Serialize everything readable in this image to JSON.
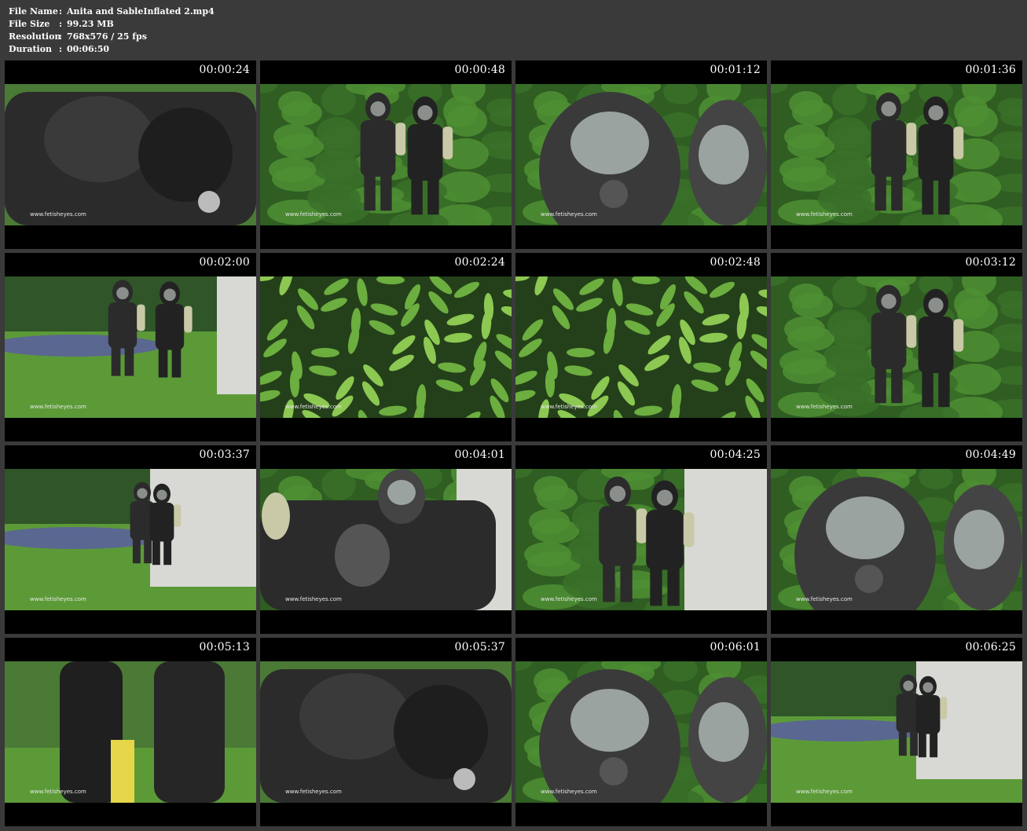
{
  "file_info": {
    "rows": [
      {
        "label": "File Name",
        "sep": ":",
        "value": "Anita and SableInflated 2.mp4"
      },
      {
        "label": "File Size",
        "sep": ":",
        "value": "99.23 MB"
      },
      {
        "label": "Resolution",
        "sep": ":",
        "value": "768x576 / 25 fps"
      },
      {
        "label": "Duration",
        "sep": ":",
        "value": "00:06:50"
      }
    ]
  },
  "watermark": "www.fetisheyes.com",
  "colors": {
    "page_bg": "#3a3a3a",
    "thumb_bg": "#000000",
    "text": "#ffffff",
    "foliage": "#3f7a2c",
    "suit": "#2b2b2b",
    "grass": "#5c9a38",
    "wall": "#d8d8d4",
    "flowers": "#5a5aa8"
  },
  "thumbnails": [
    {
      "time": "00:00:24",
      "scene": "closeup-suits",
      "icon": "video-frame"
    },
    {
      "time": "00:00:48",
      "scene": "two-figures-foliage",
      "icon": "video-frame"
    },
    {
      "time": "00:01:12",
      "scene": "closeup-masks",
      "icon": "video-frame"
    },
    {
      "time": "00:01:36",
      "scene": "two-figures-foliage",
      "icon": "video-frame"
    },
    {
      "time": "00:02:00",
      "scene": "walking-lawn",
      "icon": "video-frame"
    },
    {
      "time": "00:02:24",
      "scene": "leaves",
      "icon": "video-frame"
    },
    {
      "time": "00:02:48",
      "scene": "leaves",
      "icon": "video-frame"
    },
    {
      "time": "00:03:12",
      "scene": "two-figures-foliage",
      "icon": "video-frame"
    },
    {
      "time": "00:03:37",
      "scene": "lawn-wall",
      "icon": "video-frame"
    },
    {
      "time": "00:04:01",
      "scene": "closeup-suits-wall",
      "icon": "video-frame"
    },
    {
      "time": "00:04:25",
      "scene": "two-figures-wall",
      "icon": "video-frame"
    },
    {
      "time": "00:04:49",
      "scene": "closeup-masks",
      "icon": "video-frame"
    },
    {
      "time": "00:05:13",
      "scene": "legs-closeup",
      "icon": "video-frame"
    },
    {
      "time": "00:05:37",
      "scene": "closeup-suits",
      "icon": "video-frame"
    },
    {
      "time": "00:06:01",
      "scene": "closeup-masks",
      "icon": "video-frame"
    },
    {
      "time": "00:06:25",
      "scene": "lawn-wall",
      "icon": "video-frame"
    }
  ]
}
